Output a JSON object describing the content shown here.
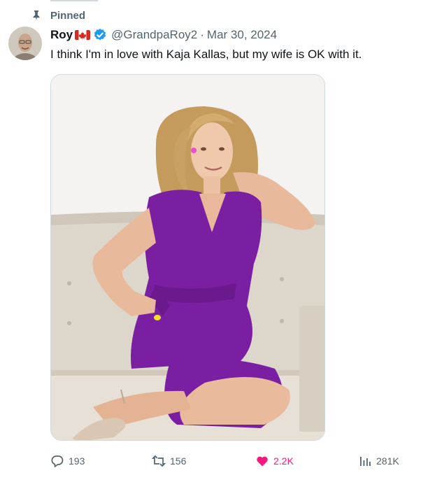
{
  "pinned": {
    "label": "Pinned",
    "icon": "pin-icon"
  },
  "author": {
    "name": "Roy",
    "flag": "canada-flag-icon",
    "verified": "verified-badge-icon",
    "handle": "@GrandpaRoy2",
    "separator": "·",
    "date": "Mar 30, 2024"
  },
  "tweet": {
    "text": "I think I'm in love with Kaja Kallas, but my wife is OK with it."
  },
  "actions": {
    "replies": "193",
    "retweets": "156",
    "likes": "2.2K",
    "views": "281K"
  },
  "colors": {
    "text_primary": "#0f1419",
    "text_secondary": "#536471",
    "verified_blue": "#1d9bf0",
    "like_pink": "#f91880",
    "dress_purple": "#7b1fa2"
  }
}
